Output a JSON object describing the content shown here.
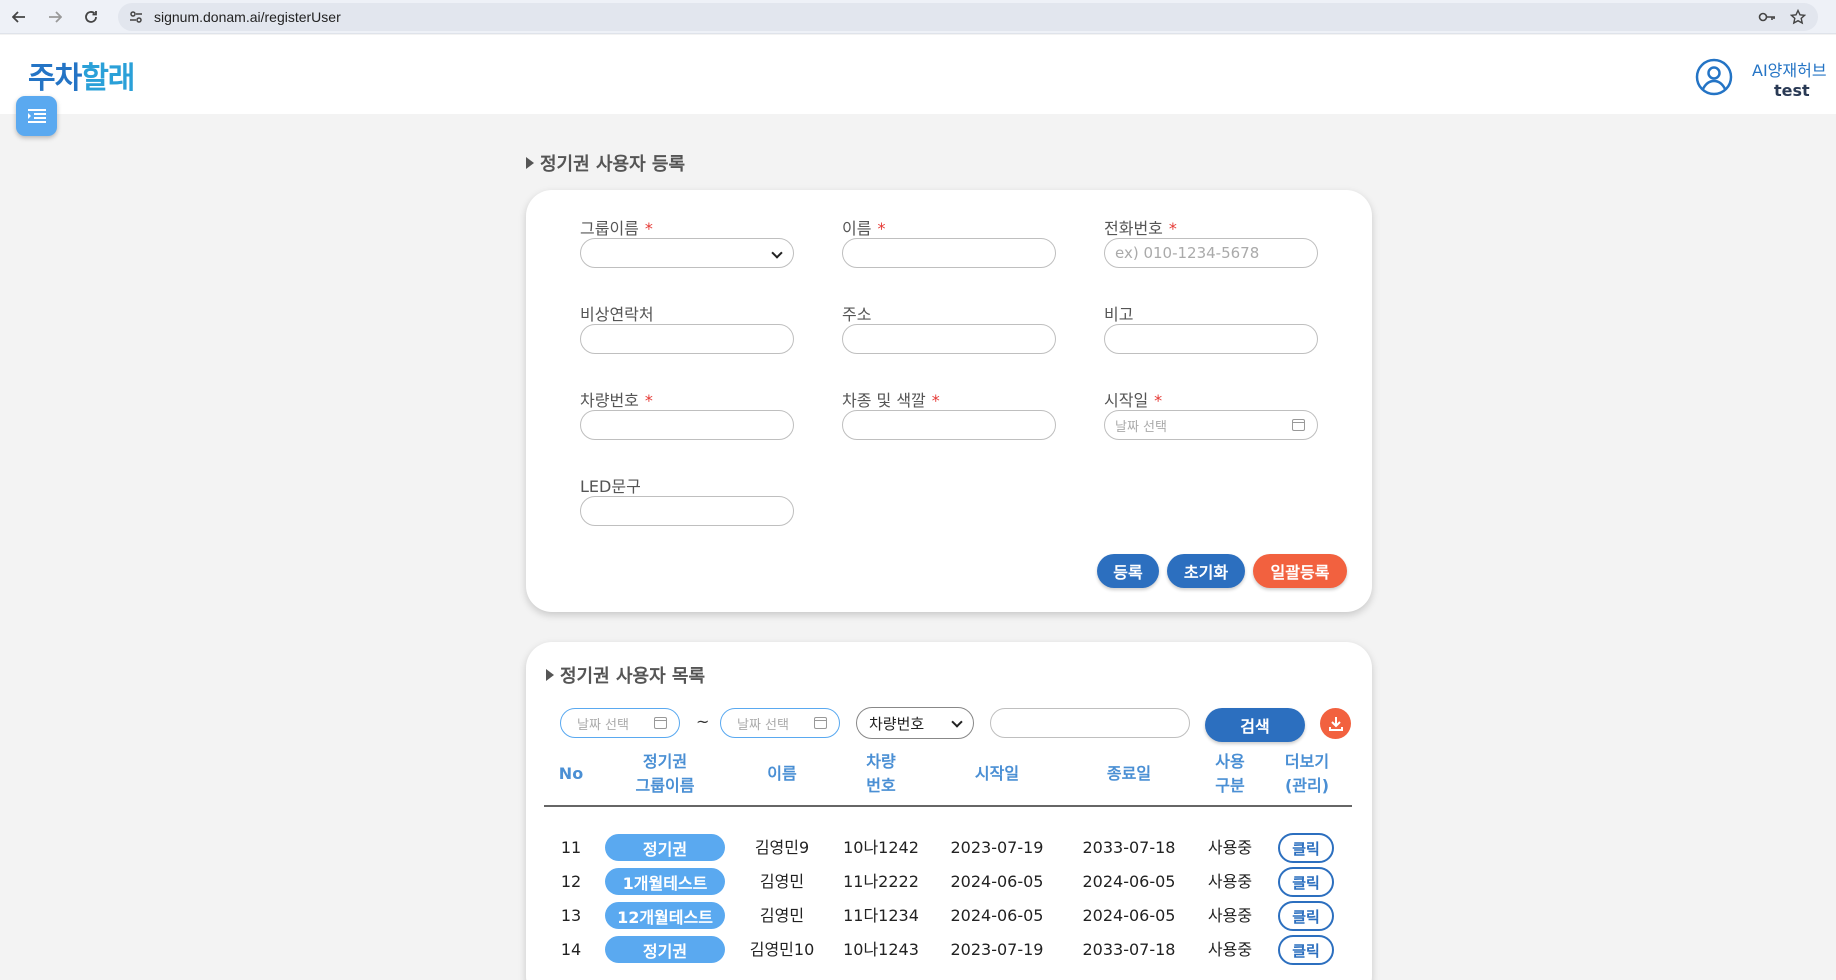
{
  "browser": {
    "url": "signum.donam.ai/registerUser"
  },
  "header": {
    "logo_part1": "주차",
    "logo_part2": "할래",
    "user_org": "AI양재허브",
    "user_name": "test"
  },
  "form": {
    "title": "정기권 사용자 등록",
    "fields": {
      "group_name": {
        "label": "그룹이름",
        "required": "*"
      },
      "name": {
        "label": "이름",
        "required": "*"
      },
      "phone": {
        "label": "전화번호",
        "required": "*",
        "placeholder": "ex) 010-1234-5678"
      },
      "emergency": {
        "label": "비상연락처"
      },
      "address": {
        "label": "주소"
      },
      "note": {
        "label": "비고"
      },
      "car_number": {
        "label": "차량번호",
        "required": "*"
      },
      "car_model": {
        "label": "차종 및 색깔",
        "required": "*"
      },
      "start_date": {
        "label": "시작일",
        "required": "*",
        "placeholder": "날짜 선택"
      },
      "led_text": {
        "label": "LED문구"
      }
    },
    "buttons": {
      "register": "등록",
      "reset": "초기화",
      "bulk": "일괄등록"
    }
  },
  "list": {
    "title": "정기권 사용자 목록",
    "filters": {
      "date_from_placeholder": "날짜 선택",
      "tilde": "~",
      "date_to_placeholder": "날짜 선택",
      "search_type": "차량번호",
      "search_button": "검색"
    },
    "columns": {
      "no": "No",
      "group_l1": "정기권",
      "group_l2": "그룹이름",
      "name": "이름",
      "car_l1": "차량",
      "car_l2": "번호",
      "start": "시작일",
      "end": "종료일",
      "use_l1": "사용",
      "use_l2": "구분",
      "more_l1": "더보기",
      "more_l2": "(관리)"
    },
    "rows": [
      {
        "no": "11",
        "group": "정기권",
        "name": "김영민9",
        "car": "10나1242",
        "start": "2023-07-19",
        "end": "2033-07-18",
        "status": "사용중",
        "action": "클릭"
      },
      {
        "no": "12",
        "group": "1개월테스트",
        "name": "김영민",
        "car": "11나2222",
        "start": "2024-06-05",
        "end": "2024-06-05",
        "status": "사용중",
        "action": "클릭"
      },
      {
        "no": "13",
        "group": "12개월테스트",
        "name": "김영민",
        "car": "11다1234",
        "start": "2024-06-05",
        "end": "2024-06-05",
        "status": "사용중",
        "action": "클릭"
      },
      {
        "no": "14",
        "group": "정기권",
        "name": "김영민10",
        "car": "10나1243",
        "start": "2023-07-19",
        "end": "2033-07-18",
        "status": "사용중",
        "action": "클릭"
      }
    ]
  },
  "colors": {
    "primary": "#2c6fbf",
    "accent_light": "#5aa9f0",
    "danger": "#f2613f"
  }
}
